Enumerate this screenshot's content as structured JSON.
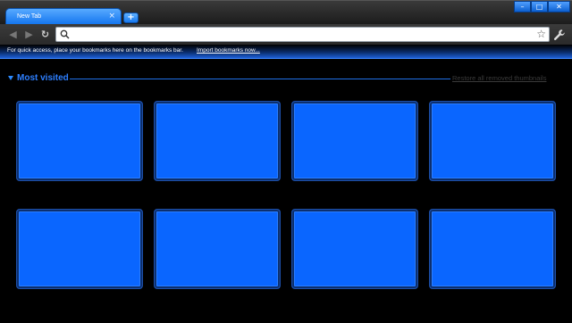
{
  "tab": {
    "title": "New Tab",
    "close_icon": "close-icon"
  },
  "new_tab_button": {
    "icon": "plus-icon",
    "label": "+"
  },
  "window_controls": {
    "minimize": "–",
    "maximize": "□",
    "close": "✕"
  },
  "toolbar": {
    "back_glyph": "◀",
    "forward_glyph": "▶",
    "reload_glyph": "↻",
    "omnibox_value": "",
    "star_glyph": "☆",
    "wrench_glyph": "🔧"
  },
  "bookmarks_bar": {
    "text": "For quick access, place your bookmarks here on the bookmarks bar.",
    "link": "Import bookmarks now..."
  },
  "most_visited": {
    "title": "Most visited",
    "restore_link": "Restore all removed thumbnails",
    "thumbnails": [
      {
        "label": ""
      },
      {
        "label": ""
      },
      {
        "label": ""
      },
      {
        "label": ""
      },
      {
        "label": ""
      },
      {
        "label": ""
      },
      {
        "label": ""
      },
      {
        "label": ""
      }
    ]
  },
  "colors": {
    "accent": "#0a66ff",
    "tab_blue": "#1173ee",
    "background": "#000000"
  }
}
